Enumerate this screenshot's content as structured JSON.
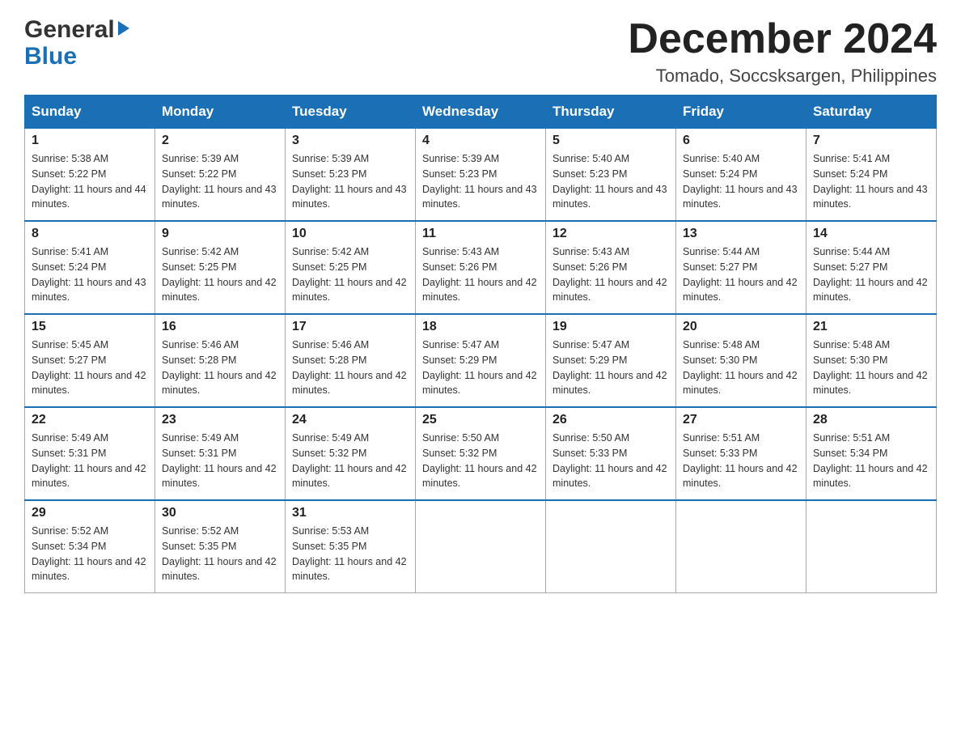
{
  "logo": {
    "general": "General",
    "blue": "Blue"
  },
  "title": "December 2024",
  "subtitle": "Tomado, Soccsksargen, Philippines",
  "headers": [
    "Sunday",
    "Monday",
    "Tuesday",
    "Wednesday",
    "Thursday",
    "Friday",
    "Saturday"
  ],
  "weeks": [
    [
      {
        "day": "1",
        "sunrise": "Sunrise: 5:38 AM",
        "sunset": "Sunset: 5:22 PM",
        "daylight": "Daylight: 11 hours and 44 minutes."
      },
      {
        "day": "2",
        "sunrise": "Sunrise: 5:39 AM",
        "sunset": "Sunset: 5:22 PM",
        "daylight": "Daylight: 11 hours and 43 minutes."
      },
      {
        "day": "3",
        "sunrise": "Sunrise: 5:39 AM",
        "sunset": "Sunset: 5:23 PM",
        "daylight": "Daylight: 11 hours and 43 minutes."
      },
      {
        "day": "4",
        "sunrise": "Sunrise: 5:39 AM",
        "sunset": "Sunset: 5:23 PM",
        "daylight": "Daylight: 11 hours and 43 minutes."
      },
      {
        "day": "5",
        "sunrise": "Sunrise: 5:40 AM",
        "sunset": "Sunset: 5:23 PM",
        "daylight": "Daylight: 11 hours and 43 minutes."
      },
      {
        "day": "6",
        "sunrise": "Sunrise: 5:40 AM",
        "sunset": "Sunset: 5:24 PM",
        "daylight": "Daylight: 11 hours and 43 minutes."
      },
      {
        "day": "7",
        "sunrise": "Sunrise: 5:41 AM",
        "sunset": "Sunset: 5:24 PM",
        "daylight": "Daylight: 11 hours and 43 minutes."
      }
    ],
    [
      {
        "day": "8",
        "sunrise": "Sunrise: 5:41 AM",
        "sunset": "Sunset: 5:24 PM",
        "daylight": "Daylight: 11 hours and 43 minutes."
      },
      {
        "day": "9",
        "sunrise": "Sunrise: 5:42 AM",
        "sunset": "Sunset: 5:25 PM",
        "daylight": "Daylight: 11 hours and 42 minutes."
      },
      {
        "day": "10",
        "sunrise": "Sunrise: 5:42 AM",
        "sunset": "Sunset: 5:25 PM",
        "daylight": "Daylight: 11 hours and 42 minutes."
      },
      {
        "day": "11",
        "sunrise": "Sunrise: 5:43 AM",
        "sunset": "Sunset: 5:26 PM",
        "daylight": "Daylight: 11 hours and 42 minutes."
      },
      {
        "day": "12",
        "sunrise": "Sunrise: 5:43 AM",
        "sunset": "Sunset: 5:26 PM",
        "daylight": "Daylight: 11 hours and 42 minutes."
      },
      {
        "day": "13",
        "sunrise": "Sunrise: 5:44 AM",
        "sunset": "Sunset: 5:27 PM",
        "daylight": "Daylight: 11 hours and 42 minutes."
      },
      {
        "day": "14",
        "sunrise": "Sunrise: 5:44 AM",
        "sunset": "Sunset: 5:27 PM",
        "daylight": "Daylight: 11 hours and 42 minutes."
      }
    ],
    [
      {
        "day": "15",
        "sunrise": "Sunrise: 5:45 AM",
        "sunset": "Sunset: 5:27 PM",
        "daylight": "Daylight: 11 hours and 42 minutes."
      },
      {
        "day": "16",
        "sunrise": "Sunrise: 5:46 AM",
        "sunset": "Sunset: 5:28 PM",
        "daylight": "Daylight: 11 hours and 42 minutes."
      },
      {
        "day": "17",
        "sunrise": "Sunrise: 5:46 AM",
        "sunset": "Sunset: 5:28 PM",
        "daylight": "Daylight: 11 hours and 42 minutes."
      },
      {
        "day": "18",
        "sunrise": "Sunrise: 5:47 AM",
        "sunset": "Sunset: 5:29 PM",
        "daylight": "Daylight: 11 hours and 42 minutes."
      },
      {
        "day": "19",
        "sunrise": "Sunrise: 5:47 AM",
        "sunset": "Sunset: 5:29 PM",
        "daylight": "Daylight: 11 hours and 42 minutes."
      },
      {
        "day": "20",
        "sunrise": "Sunrise: 5:48 AM",
        "sunset": "Sunset: 5:30 PM",
        "daylight": "Daylight: 11 hours and 42 minutes."
      },
      {
        "day": "21",
        "sunrise": "Sunrise: 5:48 AM",
        "sunset": "Sunset: 5:30 PM",
        "daylight": "Daylight: 11 hours and 42 minutes."
      }
    ],
    [
      {
        "day": "22",
        "sunrise": "Sunrise: 5:49 AM",
        "sunset": "Sunset: 5:31 PM",
        "daylight": "Daylight: 11 hours and 42 minutes."
      },
      {
        "day": "23",
        "sunrise": "Sunrise: 5:49 AM",
        "sunset": "Sunset: 5:31 PM",
        "daylight": "Daylight: 11 hours and 42 minutes."
      },
      {
        "day": "24",
        "sunrise": "Sunrise: 5:49 AM",
        "sunset": "Sunset: 5:32 PM",
        "daylight": "Daylight: 11 hours and 42 minutes."
      },
      {
        "day": "25",
        "sunrise": "Sunrise: 5:50 AM",
        "sunset": "Sunset: 5:32 PM",
        "daylight": "Daylight: 11 hours and 42 minutes."
      },
      {
        "day": "26",
        "sunrise": "Sunrise: 5:50 AM",
        "sunset": "Sunset: 5:33 PM",
        "daylight": "Daylight: 11 hours and 42 minutes."
      },
      {
        "day": "27",
        "sunrise": "Sunrise: 5:51 AM",
        "sunset": "Sunset: 5:33 PM",
        "daylight": "Daylight: 11 hours and 42 minutes."
      },
      {
        "day": "28",
        "sunrise": "Sunrise: 5:51 AM",
        "sunset": "Sunset: 5:34 PM",
        "daylight": "Daylight: 11 hours and 42 minutes."
      }
    ],
    [
      {
        "day": "29",
        "sunrise": "Sunrise: 5:52 AM",
        "sunset": "Sunset: 5:34 PM",
        "daylight": "Daylight: 11 hours and 42 minutes."
      },
      {
        "day": "30",
        "sunrise": "Sunrise: 5:52 AM",
        "sunset": "Sunset: 5:35 PM",
        "daylight": "Daylight: 11 hours and 42 minutes."
      },
      {
        "day": "31",
        "sunrise": "Sunrise: 5:53 AM",
        "sunset": "Sunset: 5:35 PM",
        "daylight": "Daylight: 11 hours and 42 minutes."
      },
      null,
      null,
      null,
      null
    ]
  ]
}
